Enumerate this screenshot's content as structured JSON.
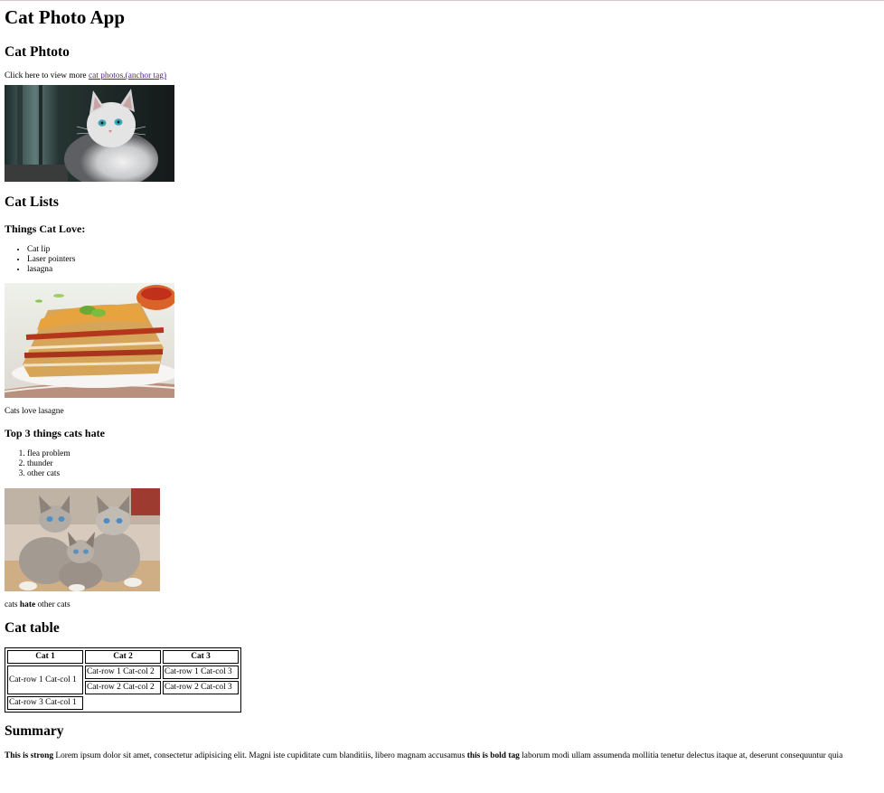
{
  "page": {
    "title": "Cat Photo App",
    "cat_photo_heading": "Cat Phtoto",
    "click_prefix": "Click here to view more ",
    "link_text": "cat photos.(anchor tag)",
    "lists_heading": "Cat Lists",
    "love_heading": "Things Cat Love:",
    "love_items": [
      "Cat lip",
      "Laser pointers",
      "lasagna"
    ],
    "lasagna_caption": "Cats love lasagne",
    "hate_heading": "Top 3 things cats hate",
    "hate_items": [
      "flea problem",
      "thunder",
      "other cats"
    ],
    "hate_caption_pre": "cats ",
    "hate_caption_bold": "hate",
    "hate_caption_post": " other cats",
    "table_heading": "Cat table",
    "table": {
      "headers": [
        "Cat 1",
        "Cat 2",
        "Cat 3"
      ],
      "rowspan_cell": "Cat-row 1 Cat-col 1",
      "r1c2": "Cat-row 1 Cat-col 2",
      "r1c3": "Cat-row 1 Cat-col 3",
      "r2c2": "Cat-row 2 Cat-col 2",
      "r2c3": "Cat-row 2 Cat-col 3",
      "r3c1": "Cat-row 3 Cat-col 1"
    },
    "summary_heading": "Summary",
    "summary": {
      "strong": "This is strong",
      "text1": " Lorem ipsum dolor sit amet, consectetur adipisicing elit. Magni iste cupiditate cum blanditiis, libero magnam accusamus ",
      "bold": "this is bold tag",
      "text2": " laborum modi ullam assumenda mollitia tenetur delectus itaque at, deserunt consequuntur quia"
    }
  }
}
